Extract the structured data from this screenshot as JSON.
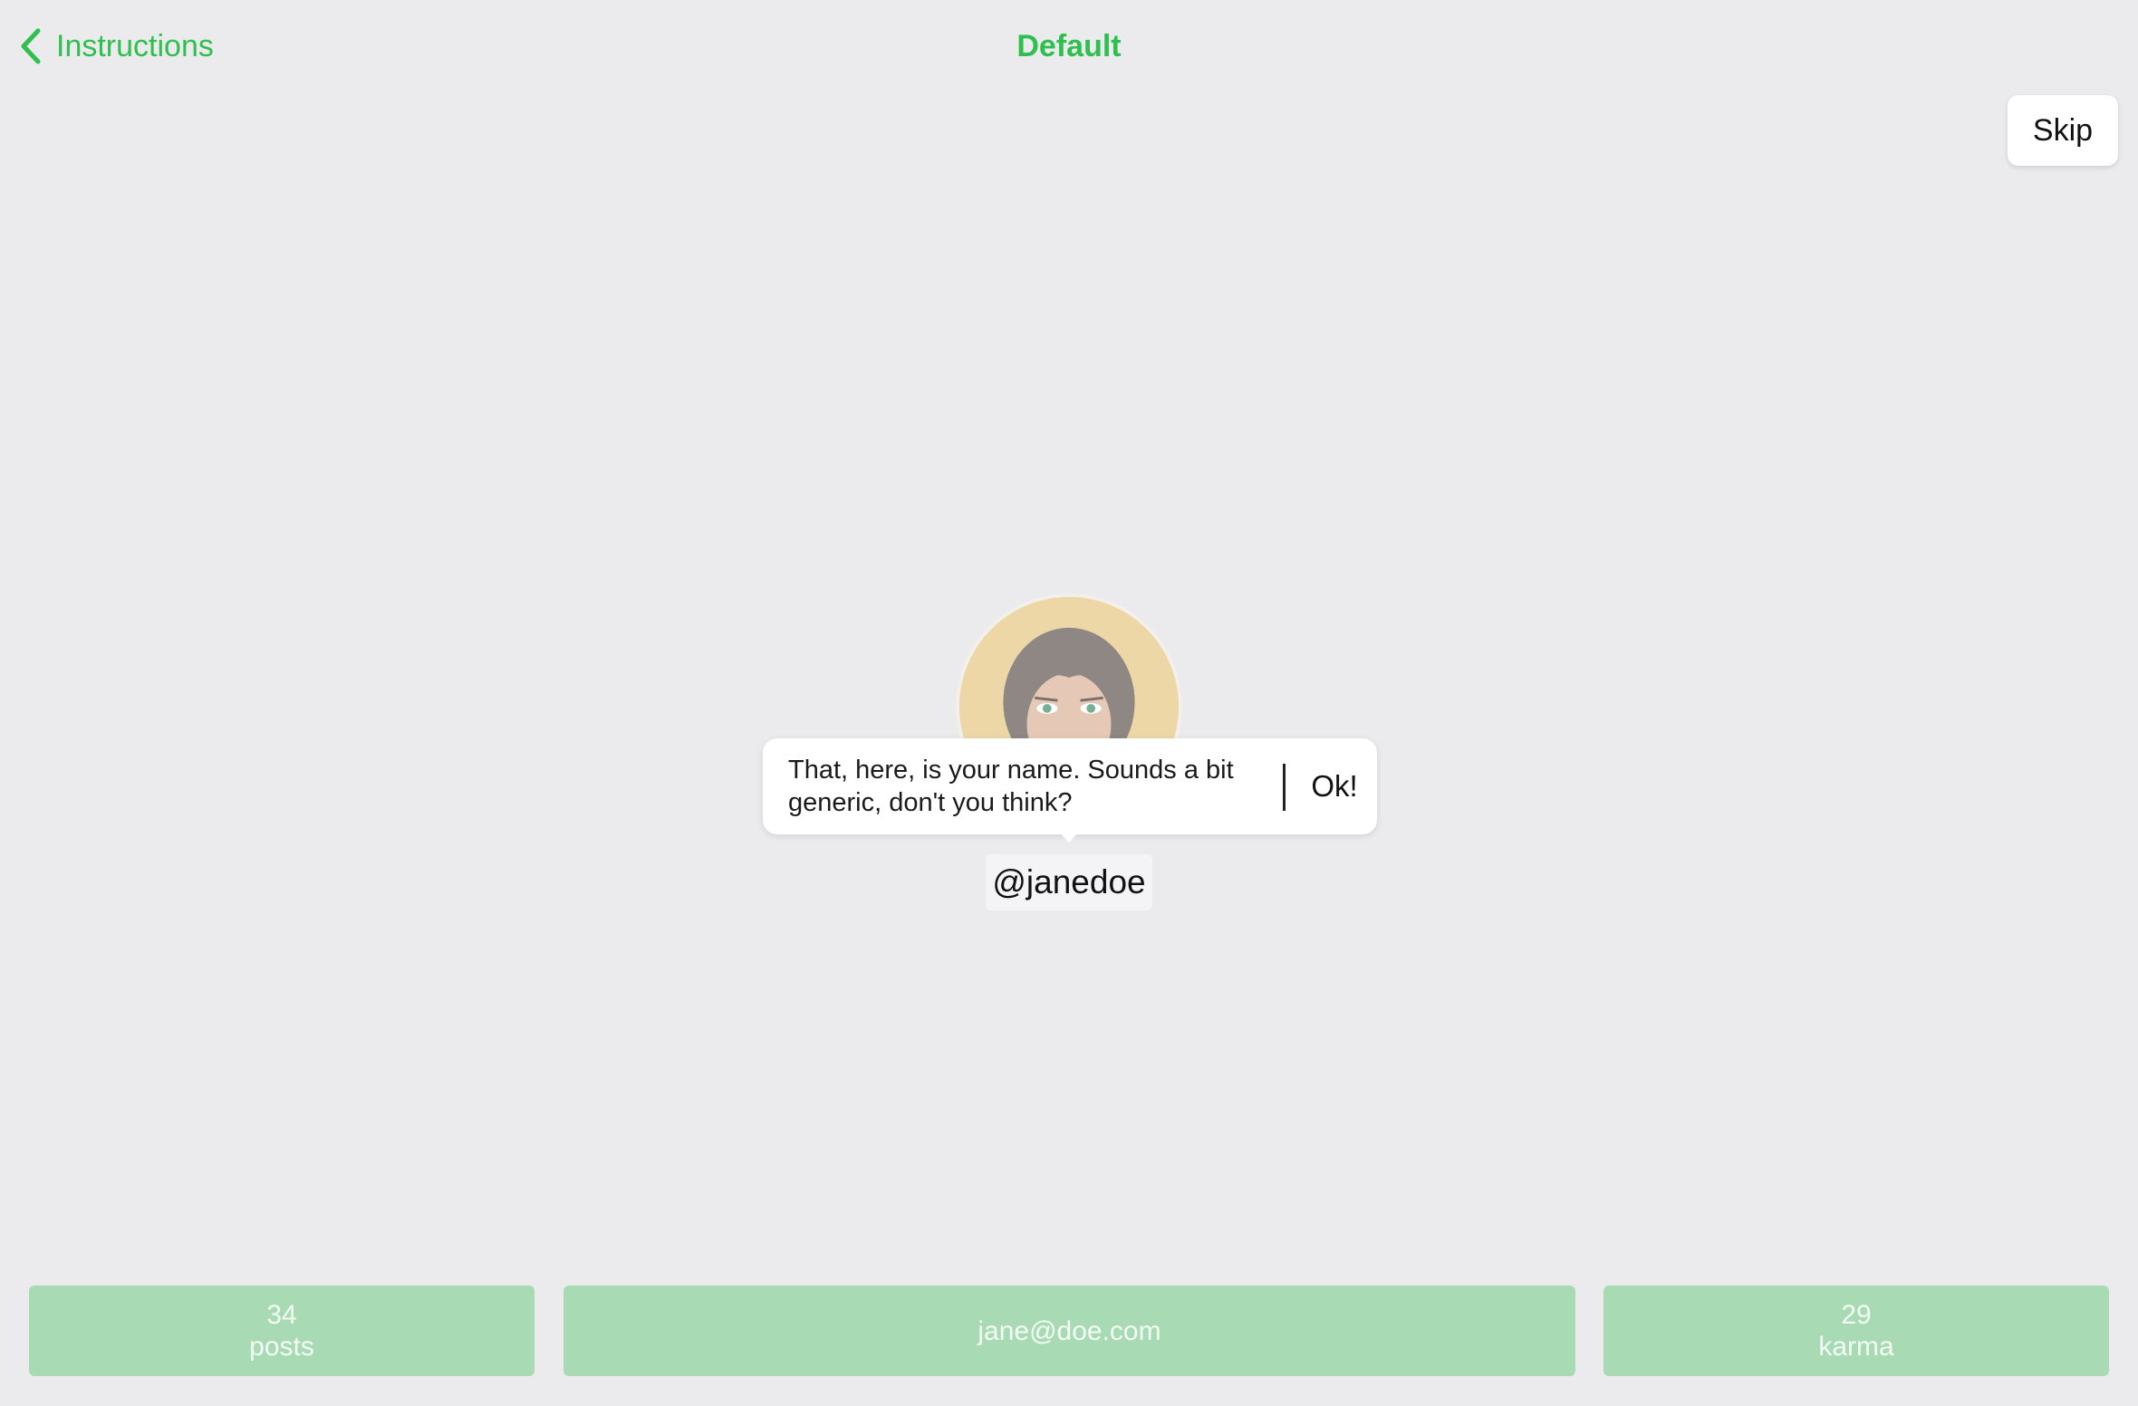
{
  "nav": {
    "back_label": "Instructions",
    "title": "Default",
    "accent_color": "#2fbf4f"
  },
  "skip_label": "Skip",
  "tooltip": {
    "message": "That, here, is your name. Sounds a bit generic, don't you think?",
    "ok_label": "Ok!"
  },
  "profile": {
    "username": "@janedoe",
    "avatar_icon": "avatar-portrait"
  },
  "stats": {
    "posts_value": "34",
    "posts_label": "posts",
    "email": "jane@doe.com",
    "karma_value": "29",
    "karma_label": "karma"
  }
}
